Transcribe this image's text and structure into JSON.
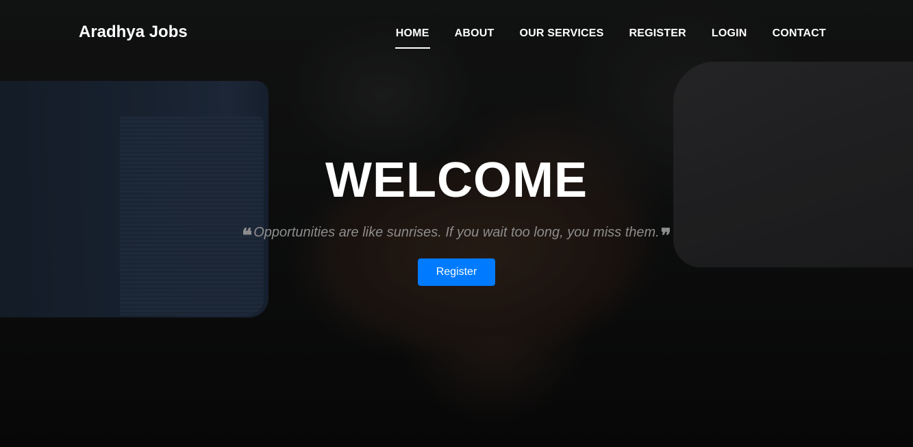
{
  "brand": {
    "name": "Aradhya Jobs"
  },
  "nav": {
    "items": [
      {
        "label": "HOME",
        "active": true
      },
      {
        "label": "ABOUT",
        "active": false
      },
      {
        "label": "OUR SERVICES",
        "active": false
      },
      {
        "label": "REGISTER",
        "active": false
      },
      {
        "label": "LOGIN",
        "active": false
      },
      {
        "label": "CONTACT",
        "active": false
      }
    ]
  },
  "hero": {
    "title": "WELCOME",
    "quote": "Opportunities are like sunrises. If you wait too long, you miss them.",
    "quote_open_icon": "quote-left-icon",
    "quote_close_icon": "quote-right-icon",
    "cta_label": "Register"
  },
  "colors": {
    "accent": "#007bff",
    "text": "#ffffff",
    "quote_text": "#8d8d8d"
  }
}
